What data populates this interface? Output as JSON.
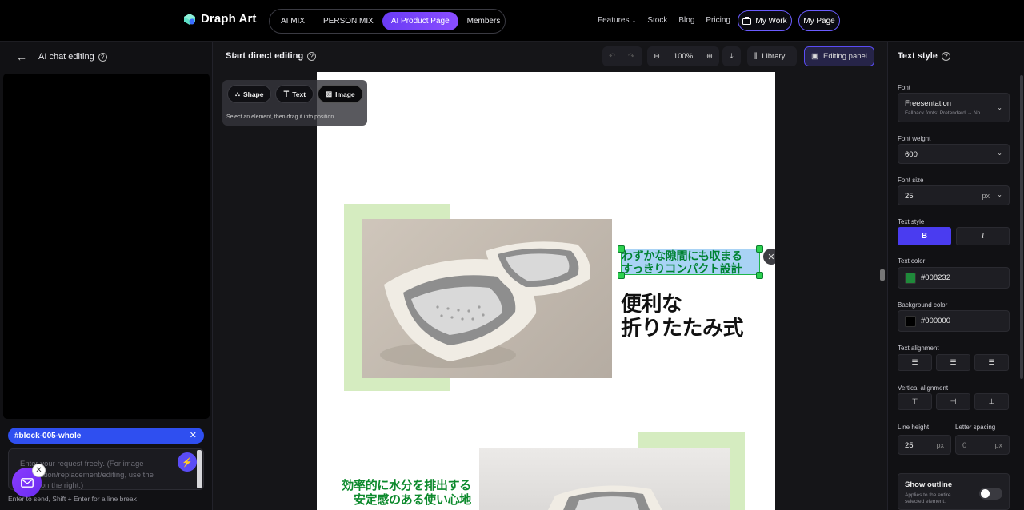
{
  "app": {
    "brand": "Draph Art"
  },
  "nav": {
    "pills": [
      "AI MIX",
      "PERSON MIX",
      "AI Product Page",
      "Members"
    ],
    "links": [
      "Features",
      "Stock",
      "Blog",
      "Pricing"
    ],
    "my_work": "My Work",
    "my_page": "My Page"
  },
  "left_panel": {
    "title": "AI chat editing",
    "tag": "#block-005-whole",
    "input_placeholder": "Enter your request freely. (For image generation/replacement/editing, use the panel on the right.)",
    "hint": "Enter to send, Shift + Enter for a line break"
  },
  "center": {
    "title": "Start direct editing",
    "zoom": "100%",
    "library": "Library",
    "editing_panel": "Editing panel",
    "tools": {
      "shape": "Shape",
      "text": "Text",
      "image": "Image",
      "hint": "Select an element, then drag it into position."
    },
    "canvas": {
      "selected_text_line1": "わずかな隙間にも収まる",
      "selected_text_line2": "すっきりコンパクト設計",
      "heading_line1": "便利な",
      "heading_line2": "折りたたみ式",
      "green_text_line1": "効率的に水分を排出する",
      "green_text_line2": "安定感のある使い心地"
    }
  },
  "right_panel": {
    "title": "Text style",
    "font_label": "Font",
    "font_value": "Freesentation",
    "font_fallback": "Fallback fonts: Pretendard → No...",
    "weight_label": "Font weight",
    "weight_value": "600",
    "size_label": "Font size",
    "size_value": "25",
    "size_unit": "px",
    "text_style_label": "Text style",
    "bold": "B",
    "italic": "I",
    "text_color_label": "Text color",
    "text_color": "#008232",
    "bg_color_label": "Background color",
    "bg_color": "#000000",
    "text_align_label": "Text alignment",
    "vertical_align_label": "Vertical alignment",
    "line_height_label": "Line height",
    "line_height_value": "25",
    "line_height_unit": "px",
    "letter_spacing_label": "Letter spacing",
    "letter_spacing_value": "0",
    "letter_spacing_unit": "px",
    "outline_label": "Show outline",
    "outline_desc_1": "Applies to the entire",
    "outline_desc_2": "selected element."
  },
  "colors": {
    "accent": "#5a4cf5",
    "selection_green": "#2cd04f",
    "text_green": "#008232",
    "highlight": "#a9d3f5"
  }
}
